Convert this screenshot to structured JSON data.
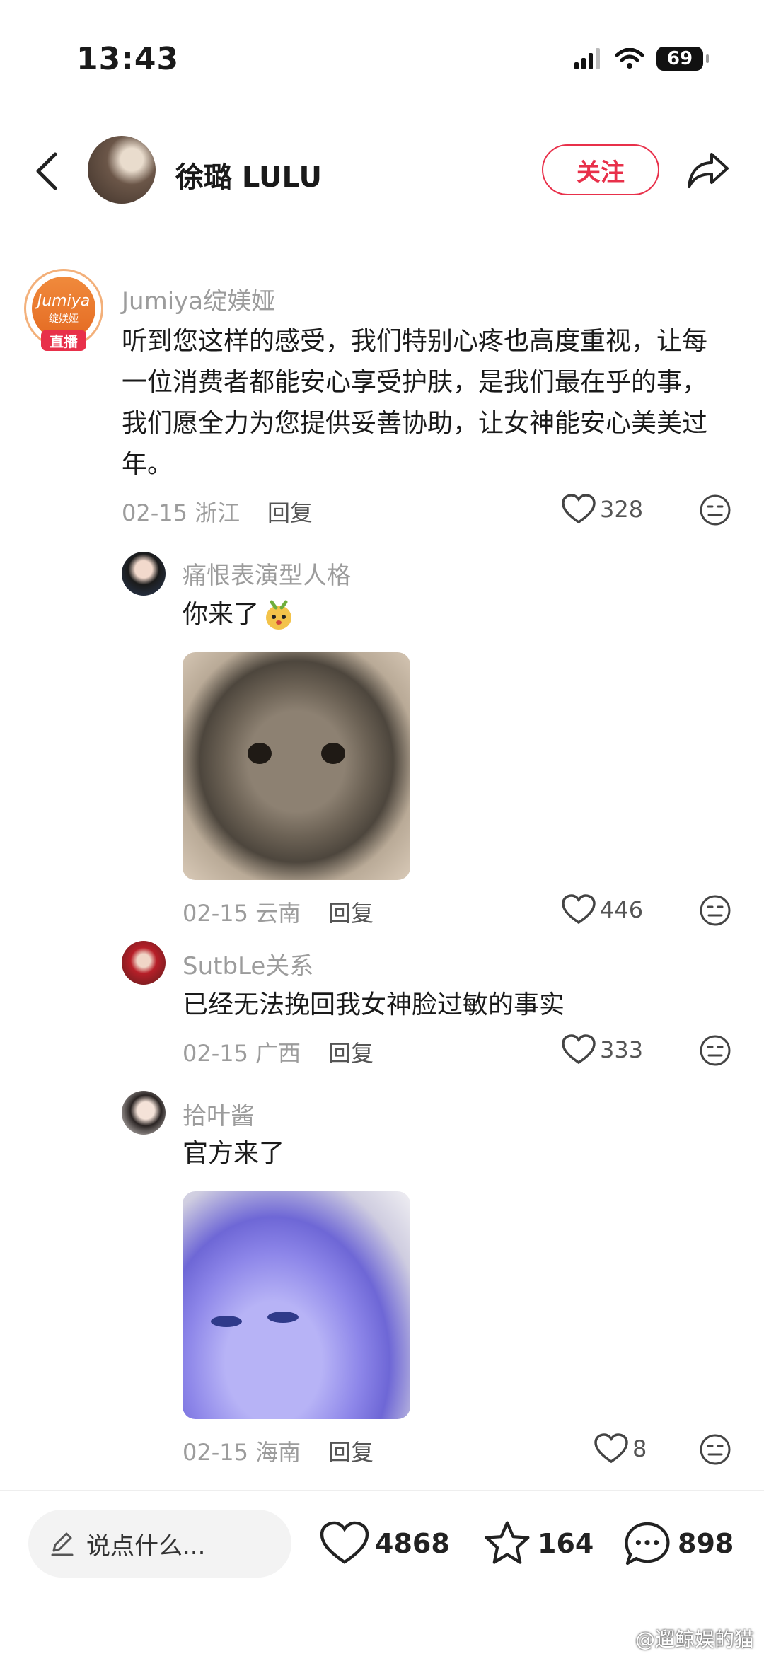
{
  "status_bar": {
    "time": "13:43",
    "battery": "69"
  },
  "header": {
    "author_name": "徐璐 LULU",
    "follow_label": "关注"
  },
  "comments": [
    {
      "name": "Jumiya绽媄娅",
      "brand_logo": "Jumiya",
      "brand_sub": "绽媄娅",
      "live_badge": "直播",
      "lines": [
        "听到您这样的感受，我们特别心疼也高度重视，让每",
        "一位消费者都能安心享受护肤，是我们最在乎的事，",
        "我们愿全力为您提供妥善协助，让女神能安心美美过",
        "年。"
      ],
      "date": "02-15",
      "location": "浙江",
      "reply": "回复",
      "likes": "328"
    },
    {
      "name": "痛恨表演型人格",
      "text": "你来了",
      "date": "02-15",
      "location": "云南",
      "reply": "回复",
      "likes": "446"
    },
    {
      "name": "SutbLe关系",
      "text": "已经无法挽回我女神脸过敏的事实",
      "date": "02-15",
      "location": "广西",
      "reply": "回复",
      "likes": "333"
    },
    {
      "name": "拾叶酱",
      "text": "官方来了",
      "date": "02-15",
      "location": "海南",
      "reply": "回复",
      "likes": "8"
    }
  ],
  "bottom_bar": {
    "input_placeholder": "说点什么...",
    "likes": "4868",
    "favorites": "164",
    "comments": "898"
  },
  "watermark": "@遛鲸娱的猫",
  "colors": {
    "accent": "#e8304a",
    "brand_orange": "#e46a22",
    "muted_text": "#9c9c9c"
  },
  "icons": [
    "back-icon",
    "share-icon",
    "heart-icon",
    "meh-emoji-icon",
    "pencil-icon",
    "star-icon",
    "chat-bubble-icon",
    "wifi-icon",
    "signal-icon"
  ]
}
